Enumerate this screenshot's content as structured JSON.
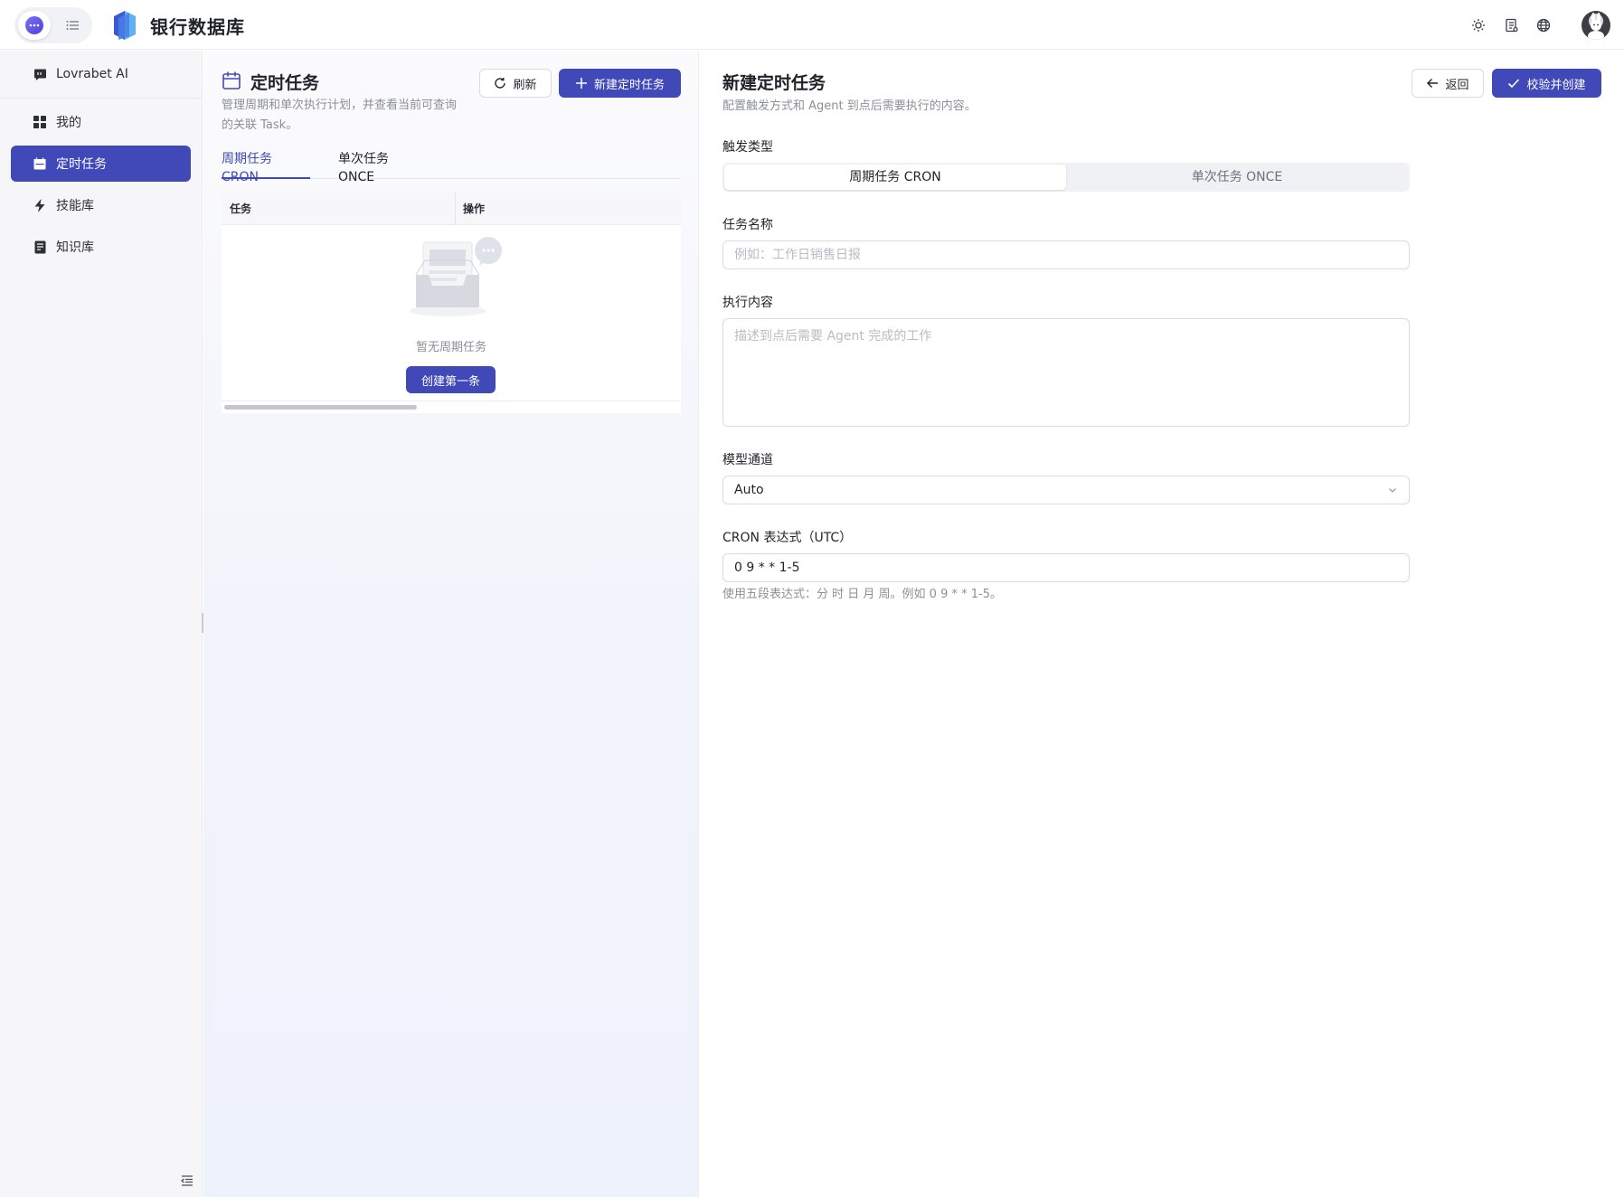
{
  "app": {
    "title": "银行数据库"
  },
  "header": {
    "icons": [
      "chat-mode-icon",
      "list-mode-icon",
      "sun-icon",
      "document-icon",
      "globe-icon",
      "user-avatar"
    ]
  },
  "sidebar": {
    "items": [
      {
        "label": "Lovrabet AI",
        "icon": "chat-bubble-icon",
        "active": false
      },
      {
        "label": "我的",
        "icon": "grid-icon",
        "active": false
      },
      {
        "label": "定时任务",
        "icon": "calendar-icon",
        "active": true
      },
      {
        "label": "技能库",
        "icon": "lightning-icon",
        "active": false
      },
      {
        "label": "知识库",
        "icon": "book-icon",
        "active": false
      }
    ]
  },
  "tasks_panel": {
    "title": "定时任务",
    "description": "管理周期和单次执行计划，并查看当前可查询的关联 Task。",
    "refresh_label": "刷新",
    "new_task_label": "新建定时任务",
    "tabs": [
      {
        "label": "周期任务 CRON",
        "active": true
      },
      {
        "label": "单次任务 ONCE",
        "active": false
      }
    ],
    "table": {
      "columns": [
        "任务",
        "操作"
      ],
      "empty_text": "暂无周期任务",
      "create_first_label": "创建第一条"
    }
  },
  "form": {
    "title": "新建定时任务",
    "description": "配置触发方式和 Agent 到点后需要执行的内容。",
    "back_label": "返回",
    "submit_label": "校验并创建",
    "trigger_type": {
      "label": "触发类型",
      "options": [
        "周期任务 CRON",
        "单次任务 ONCE"
      ],
      "selected": "周期任务 CRON"
    },
    "task_name": {
      "label": "任务名称",
      "placeholder": "例如：工作日销售日报",
      "value": ""
    },
    "content": {
      "label": "执行内容",
      "placeholder": "描述到点后需要 Agent 完成的工作",
      "value": ""
    },
    "model_channel": {
      "label": "模型通道",
      "value": "Auto"
    },
    "cron": {
      "label": "CRON 表达式（UTC）",
      "value": "0 9 * * 1-5",
      "hint": "使用五段表达式：分 时 日 月 周。例如 0 9 * * 1-5。"
    }
  },
  "colors": {
    "primary": "#4149b8",
    "sidebar_bg": "#f6f6f8",
    "muted_text": "#8a8f99"
  }
}
